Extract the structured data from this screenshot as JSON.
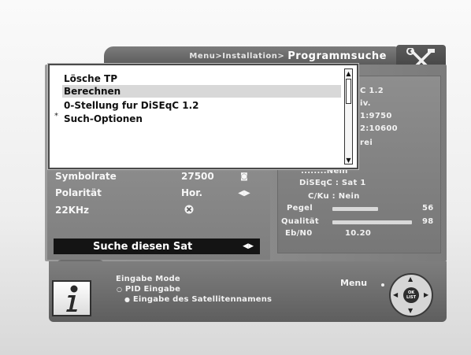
{
  "header": {
    "breadcrumb": "Menu>Installation>",
    "title": "Programmsuche",
    "tools_icon": "tools-icon"
  },
  "popup": {
    "items": [
      {
        "label": "Lösche TP",
        "bullet": ""
      },
      {
        "label": "Berechnen",
        "bullet": ""
      },
      {
        "label": "0-Stellung fur DiSEqC 1.2",
        "bullet": ""
      },
      {
        "label": "Such-Optionen",
        "bullet": "*"
      }
    ]
  },
  "settings": [
    {
      "label": "Symbolrate",
      "value": "27500",
      "indicator": "ok-icon"
    },
    {
      "label": "Polarität",
      "value": "Hor.",
      "indicator": "left-right-arrows-icon"
    },
    {
      "label": "22KHz",
      "value": "",
      "indicator": "x-icon"
    }
  ],
  "search_bar": {
    "label": "Suche diesen Sat",
    "indicator": "left-right-arrows-icon"
  },
  "satellite_info": {
    "partial_lines": [
      "C 1.2",
      "iv.",
      "1:9750",
      "2:10600",
      "rei"
    ],
    "partial_line_6": "........Nein",
    "diseqc": "DiSEqC : Sat 1",
    "cku": "C/Ku : Nein",
    "pegel_label": "Pegel",
    "pegel_value": "56",
    "pegel_fraction": 0.56,
    "qualitaet_label": "Qualität",
    "qualitaet_value": "98",
    "qualitaet_fraction": 0.98,
    "ebno_label": "Eb/N0",
    "ebno_value": "10.20"
  },
  "help": {
    "title": "Eingabe Mode",
    "option1": "PID Eingabe",
    "option2": "Eingabe des Satellitennamens",
    "menu_label": "Menu",
    "dpad_center": "OK LIST"
  },
  "colors": {
    "panel": "#8a8a8a",
    "popup_bg": "#ffffff",
    "selection": "#d8d8d8",
    "search_bar": "#141414"
  }
}
